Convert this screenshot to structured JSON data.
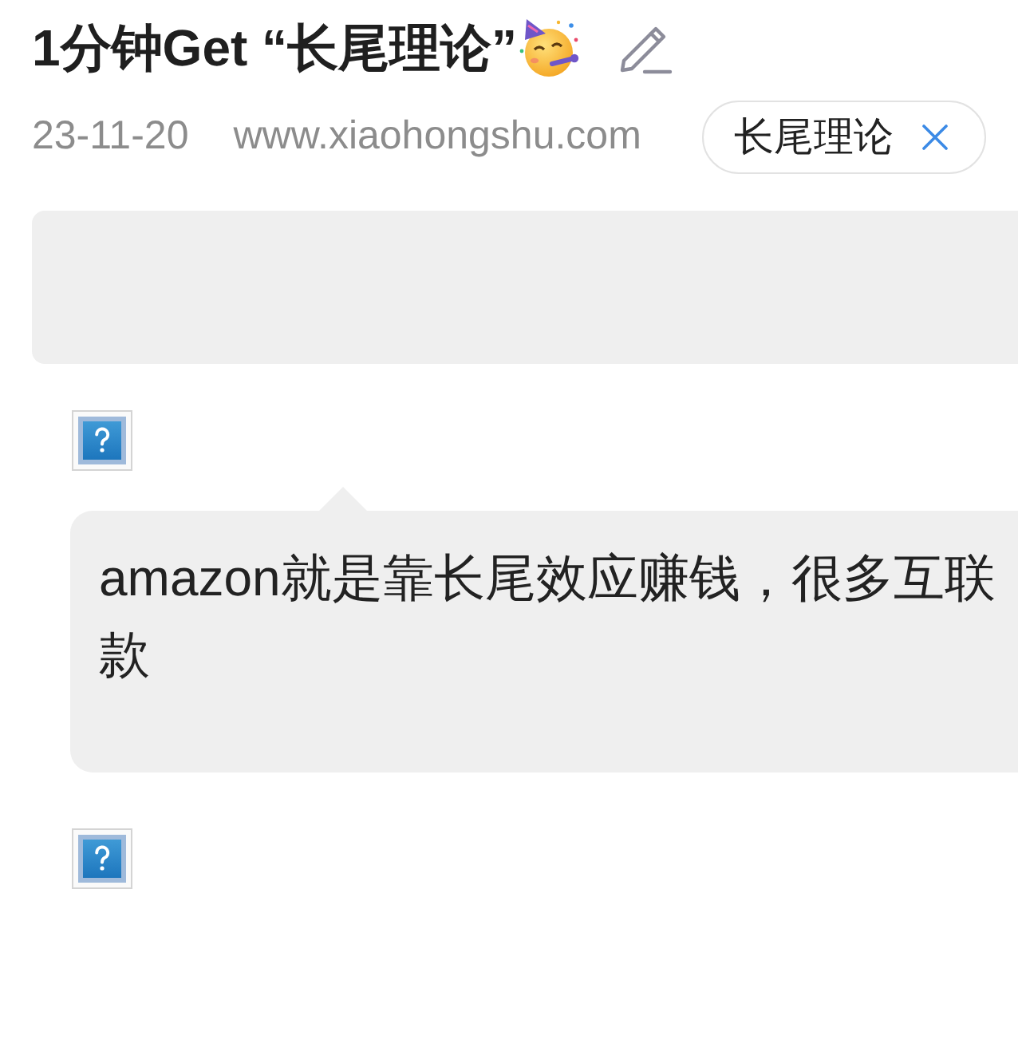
{
  "note": {
    "title": "1分钟Get “长尾理论”",
    "date": "23-11-20",
    "source": "www.xiaohongshu.com",
    "tags": [
      {
        "label": "长尾理论"
      }
    ]
  },
  "content": [
    {
      "kind": "panel"
    },
    {
      "kind": "image"
    },
    {
      "kind": "bubble",
      "lines": [
        "amazon就是靠长尾效应赚钱，很多互联",
        "款"
      ]
    },
    {
      "kind": "image"
    }
  ]
}
